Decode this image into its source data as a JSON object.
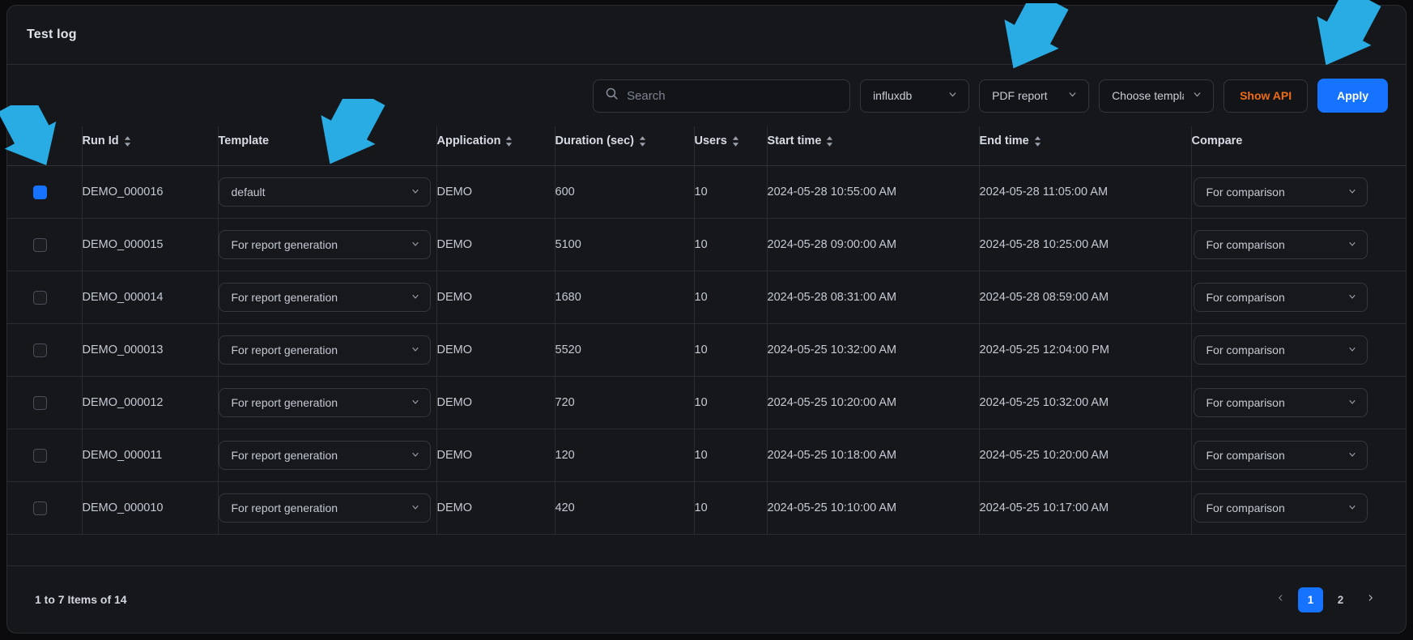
{
  "header": {
    "title": "Test log"
  },
  "toolbar": {
    "search": {
      "placeholder": "Search",
      "value": "",
      "icon": "search-icon"
    },
    "datasource_select": {
      "value": "influxdb",
      "icon": "chevron-down-icon"
    },
    "report_select": {
      "value": "PDF report",
      "icon": "chevron-down-icon"
    },
    "template_select": {
      "value": "Choose template",
      "icon": "chevron-down-icon"
    },
    "show_api_label": "Show API",
    "apply_label": "Apply",
    "accent_orange": "#ef6c17",
    "accent_blue": "#1673ff"
  },
  "table": {
    "columns": [
      {
        "label": "",
        "sortable": false,
        "key": "select"
      },
      {
        "label": "Run Id",
        "sortable": true,
        "key": "run_id"
      },
      {
        "label": "Template",
        "sortable": false,
        "key": "template"
      },
      {
        "label": "Application",
        "sortable": true,
        "key": "application"
      },
      {
        "label": "Duration (sec)",
        "sortable": true,
        "key": "duration"
      },
      {
        "label": "Users",
        "sortable": true,
        "key": "users"
      },
      {
        "label": "Start time",
        "sortable": true,
        "key": "start_time"
      },
      {
        "label": "End time",
        "sortable": true,
        "key": "end_time"
      },
      {
        "label": "Compare",
        "sortable": false,
        "key": "compare"
      }
    ],
    "rows": [
      {
        "selected": true,
        "run_id": "DEMO_000016",
        "template": "default",
        "application": "DEMO",
        "duration": "600",
        "users": "10",
        "start_time": "2024-05-28 10:55:00 AM",
        "end_time": "2024-05-28 11:05:00 AM",
        "compare": "For comparison"
      },
      {
        "selected": false,
        "run_id": "DEMO_000015",
        "template": "For report generation",
        "application": "DEMO",
        "duration": "5100",
        "users": "10",
        "start_time": "2024-05-28 09:00:00 AM",
        "end_time": "2024-05-28 10:25:00 AM",
        "compare": "For comparison"
      },
      {
        "selected": false,
        "run_id": "DEMO_000014",
        "template": "For report generation",
        "application": "DEMO",
        "duration": "1680",
        "users": "10",
        "start_time": "2024-05-28 08:31:00 AM",
        "end_time": "2024-05-28 08:59:00 AM",
        "compare": "For comparison"
      },
      {
        "selected": false,
        "run_id": "DEMO_000013",
        "template": "For report generation",
        "application": "DEMO",
        "duration": "5520",
        "users": "10",
        "start_time": "2024-05-25 10:32:00 AM",
        "end_time": "2024-05-25 12:04:00 PM",
        "compare": "For comparison"
      },
      {
        "selected": false,
        "run_id": "DEMO_000012",
        "template": "For report generation",
        "application": "DEMO",
        "duration": "720",
        "users": "10",
        "start_time": "2024-05-25 10:20:00 AM",
        "end_time": "2024-05-25 10:32:00 AM",
        "compare": "For comparison"
      },
      {
        "selected": false,
        "run_id": "DEMO_000011",
        "template": "For report generation",
        "application": "DEMO",
        "duration": "120",
        "users": "10",
        "start_time": "2024-05-25 10:18:00 AM",
        "end_time": "2024-05-25 10:20:00 AM",
        "compare": "For comparison"
      },
      {
        "selected": false,
        "run_id": "DEMO_000010",
        "template": "For report generation",
        "application": "DEMO",
        "duration": "420",
        "users": "10",
        "start_time": "2024-05-25 10:10:00 AM",
        "end_time": "2024-05-25 10:17:00 AM",
        "compare": "For comparison"
      }
    ]
  },
  "footer": {
    "items_label": "1 to 7 Items of 14",
    "pagination": {
      "prev_icon": "chevron-left-icon",
      "next_icon": "chevron-right-icon",
      "pages": [
        "1",
        "2"
      ],
      "active_page": "1"
    }
  },
  "annotations": {
    "color": "#29ace4",
    "arrows": [
      {
        "name": "arrow-pointing-row-checkbox"
      },
      {
        "name": "arrow-pointing-template-column"
      },
      {
        "name": "arrow-pointing-report-select"
      },
      {
        "name": "arrow-pointing-apply-button"
      }
    ]
  }
}
